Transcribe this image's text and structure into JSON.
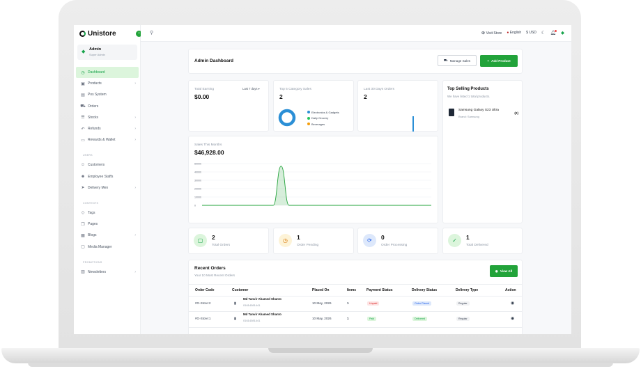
{
  "brand": {
    "name": "Unistore"
  },
  "profile": {
    "name": "Admin",
    "role": "Super Admin"
  },
  "sidebar": {
    "main": [
      {
        "label": "Dashboard",
        "icon": "clock-icon",
        "active": true
      },
      {
        "label": "Products",
        "icon": "box-icon",
        "chevron": true
      },
      {
        "label": "Pos System",
        "icon": "pos-icon"
      },
      {
        "label": "Orders",
        "icon": "cart-icon"
      },
      {
        "label": "Stocks",
        "icon": "database-icon",
        "chevron": true
      },
      {
        "label": "Refunds",
        "icon": "undo-icon",
        "chevron": true
      },
      {
        "label": "Rewards & Wallet",
        "icon": "wallet-icon",
        "chevron": true
      }
    ],
    "users_title": "USERS",
    "users": [
      {
        "label": "Customers",
        "icon": "users-icon"
      },
      {
        "label": "Employee Staffs",
        "icon": "user-plus-icon"
      },
      {
        "label": "Delivery Men",
        "icon": "send-icon",
        "chevron": true
      }
    ],
    "contents_title": "CONTENTS",
    "contents": [
      {
        "label": "Tags",
        "icon": "tag-icon"
      },
      {
        "label": "Pages",
        "icon": "pages-icon"
      },
      {
        "label": "Blogs",
        "icon": "blog-icon",
        "chevron": true
      },
      {
        "label": "Media Manager",
        "icon": "folder-icon"
      }
    ],
    "promotions_title": "PROMOTIONS",
    "promotions": [
      {
        "label": "Newsletters",
        "icon": "book-icon",
        "chevron": true
      }
    ]
  },
  "topbar": {
    "visit_store": "Visit Store",
    "language": "English",
    "currency": "$ USD"
  },
  "header": {
    "title": "Admin Dashboard",
    "manage_sales": "Manage Sales",
    "add_product": "Add Product"
  },
  "earning": {
    "label": "Total Earning",
    "value": "$0.00",
    "period": "Last 7 days"
  },
  "category": {
    "label": "Top 5 Category Sales",
    "value": "2",
    "legend": [
      {
        "name": "Electronics & Gadgets",
        "color": "#2b8fd6"
      },
      {
        "name": "Daily Grocery",
        "color": "#22c55e"
      },
      {
        "name": "Beverages",
        "color": "#f59e0b"
      }
    ]
  },
  "last30": {
    "label": "Last 30 Days Orders",
    "value": "2"
  },
  "top_selling": {
    "title": "Top Selling Products",
    "subtitle": "We have listed 1 total products.",
    "items": [
      {
        "name": "Samsung Galaxy S23 Ultra",
        "brand": "Brand: Samsung",
        "count": "(2)"
      }
    ]
  },
  "sales": {
    "label": "Sales This Months",
    "value": "$46,928.00"
  },
  "chart_data": {
    "type": "area",
    "title": "Sales This Months",
    "yticks": [
      "50000",
      "40000",
      "30000",
      "20000",
      "10000",
      "0"
    ],
    "ylim": [
      0,
      50000
    ],
    "x": [
      1,
      2,
      3,
      4,
      5,
      6,
      7,
      8,
      9,
      10,
      11,
      12,
      13,
      14,
      15,
      16,
      17,
      18,
      19,
      20,
      21,
      22,
      23,
      24,
      25,
      26,
      27,
      28,
      29,
      30
    ],
    "series": [
      {
        "values": [
          0,
          0,
          0,
          0,
          0,
          0,
          0,
          0,
          0,
          0,
          46928,
          0,
          0,
          0,
          0,
          0,
          0,
          0,
          0,
          0,
          0,
          0,
          0,
          0,
          0,
          0,
          0,
          0,
          0,
          0
        ],
        "color": "#22a33a"
      }
    ]
  },
  "stats": [
    {
      "value": "2",
      "label": "Total Orders",
      "icon": "bag-icon",
      "color": "#16a34a",
      "bg": "#dcf5dc"
    },
    {
      "value": "1",
      "label": "Order Pending",
      "icon": "clock-icon",
      "color": "#d97706",
      "bg": "#fdf3d7"
    },
    {
      "value": "0",
      "label": "Order Processing",
      "icon": "refresh-icon",
      "color": "#2563eb",
      "bg": "#dde8fb"
    },
    {
      "value": "1",
      "label": "Total Delivered",
      "icon": "check-circle-icon",
      "color": "#16a34a",
      "bg": "#dcf5dc"
    }
  ],
  "recent": {
    "title": "Recent Orders",
    "subtitle": "Your 10 Most Recent Orders",
    "view_all": "View All",
    "columns": [
      "Order Code",
      "Customer",
      "Placed On",
      "Items",
      "Payment Status",
      "Delivery Status",
      "Delivery Type",
      "Action"
    ],
    "rows": [
      {
        "code": "#G-Store:2",
        "customer": "Md Tanvir Ahamed Shanto",
        "phone": "01614081441",
        "placed": "10 May, 2026",
        "items": "1",
        "payment": "Unpaid",
        "delivery": "Order Placed",
        "type": "Regular"
      },
      {
        "code": "#G-Store:1",
        "customer": "Md Tanvir Ahamed Shanto",
        "phone": "01614081441",
        "placed": "10 May, 2026",
        "items": "1",
        "payment": "Paid",
        "delivery": "Delivered",
        "type": "Regular"
      }
    ]
  }
}
